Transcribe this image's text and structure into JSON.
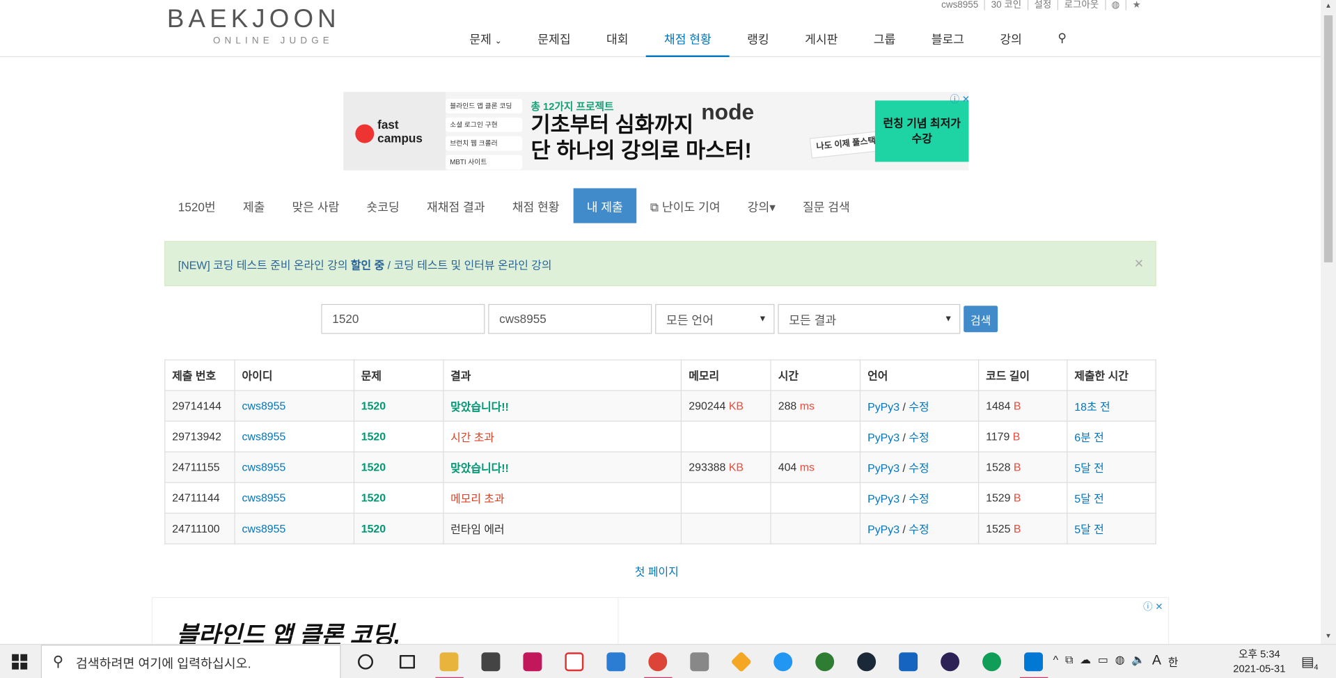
{
  "header": {
    "logo_main": "BAEKJOON",
    "logo_sub": "ONLINE JUDGE",
    "user_links": [
      "cws8955",
      "30 코인",
      "설정",
      "로그아웃"
    ],
    "nav": [
      "문제",
      "문제집",
      "대회",
      "채점 현황",
      "랭킹",
      "게시판",
      "그룹",
      "블로그",
      "강의"
    ],
    "active_nav": "채점 현황"
  },
  "ad_top": {
    "brand": "fast campus",
    "tags": [
      "블라인드 앱 클론 코딩",
      "소셜 로그인 구현",
      "브런치 웹 크롤러",
      "MBTI 사이트"
    ],
    "headline": "총 12가지 프로젝트",
    "big_line1": "기초부터 심화까지",
    "big_line2": "단 하나의 강의로 마스터!",
    "node": "node",
    "sticker": "나도 이제 풀스택 개발자!",
    "cta": "런칭 기념 최저가 수강"
  },
  "subnav": [
    "1520번",
    "제출",
    "맞은 사람",
    "숏코딩",
    "재채점 결과",
    "채점 현황",
    "내 제출",
    "난이도 기여",
    "강의▾",
    "질문 검색"
  ],
  "subnav_active": "내 제출",
  "alert": {
    "prefix": "[NEW] 코딩 테스트 준비 온라인 강의 ",
    "bold": "할인 중",
    "suffix": " / 코딩 테스트 및 인터뷰 온라인 강의",
    "close": "×"
  },
  "search": {
    "problem": "1520",
    "user": "cws8955",
    "language": "모든 언어",
    "result": "모든 결과",
    "button": "검색"
  },
  "table": {
    "headers": [
      "제출 번호",
      "아이디",
      "문제",
      "결과",
      "메모리",
      "시간",
      "언어",
      "코드 길이",
      "제출한 시간"
    ],
    "rows": [
      {
        "id": "29714144",
        "user": "cws8955",
        "problem": "1520",
        "result": "맞았습니다!!",
        "result_type": "ok",
        "memory": "290244",
        "time": "288",
        "lang": "PyPy3",
        "edit": "수정",
        "len": "1484",
        "when": "18초 전"
      },
      {
        "id": "29713942",
        "user": "cws8955",
        "problem": "1520",
        "result": "시간 초과",
        "result_type": "fail",
        "memory": "",
        "time": "",
        "lang": "PyPy3",
        "edit": "수정",
        "len": "1179",
        "when": "6분 전"
      },
      {
        "id": "24711155",
        "user": "cws8955",
        "problem": "1520",
        "result": "맞았습니다!!",
        "result_type": "ok",
        "memory": "293388",
        "time": "404",
        "lang": "PyPy3",
        "edit": "수정",
        "len": "1528",
        "when": "5달 전"
      },
      {
        "id": "24711144",
        "user": "cws8955",
        "problem": "1520",
        "result": "메모리 초과",
        "result_type": "fail",
        "memory": "",
        "time": "",
        "lang": "PyPy3",
        "edit": "수정",
        "len": "1529",
        "when": "5달 전"
      },
      {
        "id": "24711100",
        "user": "cws8955",
        "problem": "1520",
        "result": "런타임 에러",
        "result_type": "rte",
        "memory": "",
        "time": "",
        "lang": "PyPy3",
        "edit": "수정",
        "len": "1525",
        "when": "5달 전"
      }
    ],
    "mem_unit": "KB",
    "time_unit": "ms",
    "len_unit": "B"
  },
  "first_page": "첫 페이지",
  "ad_bottom": {
    "text": "블라인드 앱 클론 코딩,"
  },
  "taskbar": {
    "search_placeholder": "검색하려면 여기에 입력하십시오.",
    "clock_time": "오후 5:34",
    "clock_date": "2021-05-31",
    "ime": "한",
    "font_a": "A",
    "notif_count": "4"
  },
  "colors": {
    "accent": "#0076c0",
    "ok": "#009874",
    "fail": "#dd4124",
    "button": "#428bca",
    "alert_bg": "#dff0d8"
  }
}
